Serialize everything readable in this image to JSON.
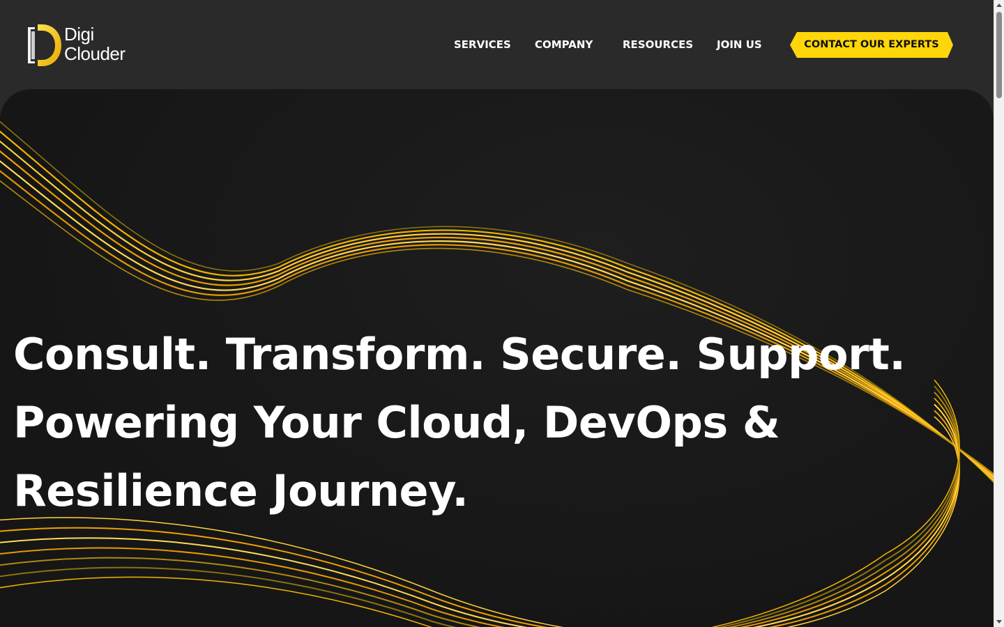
{
  "brand": {
    "logo_line1": "Digi",
    "logo_line2": "Clouder",
    "accent_color": "#FFD60A"
  },
  "nav": {
    "items": [
      {
        "label": "SERVICES"
      },
      {
        "label": "COMPANY"
      },
      {
        "label": "RESOURCES"
      },
      {
        "label": "JOIN US"
      }
    ],
    "cta_label": "CONTACT OUR EXPERTS"
  },
  "hero": {
    "headline_line1": "Consult. Transform. Secure. Support.",
    "headline_line2": "Powering Your Cloud, DevOps &",
    "headline_line3": "Resilience Journey."
  },
  "icons": {
    "logo": "digiclouder-logo-mark",
    "scroll_up": "scroll-up-arrow-icon",
    "scroll_down": "scroll-down-arrow-icon"
  }
}
